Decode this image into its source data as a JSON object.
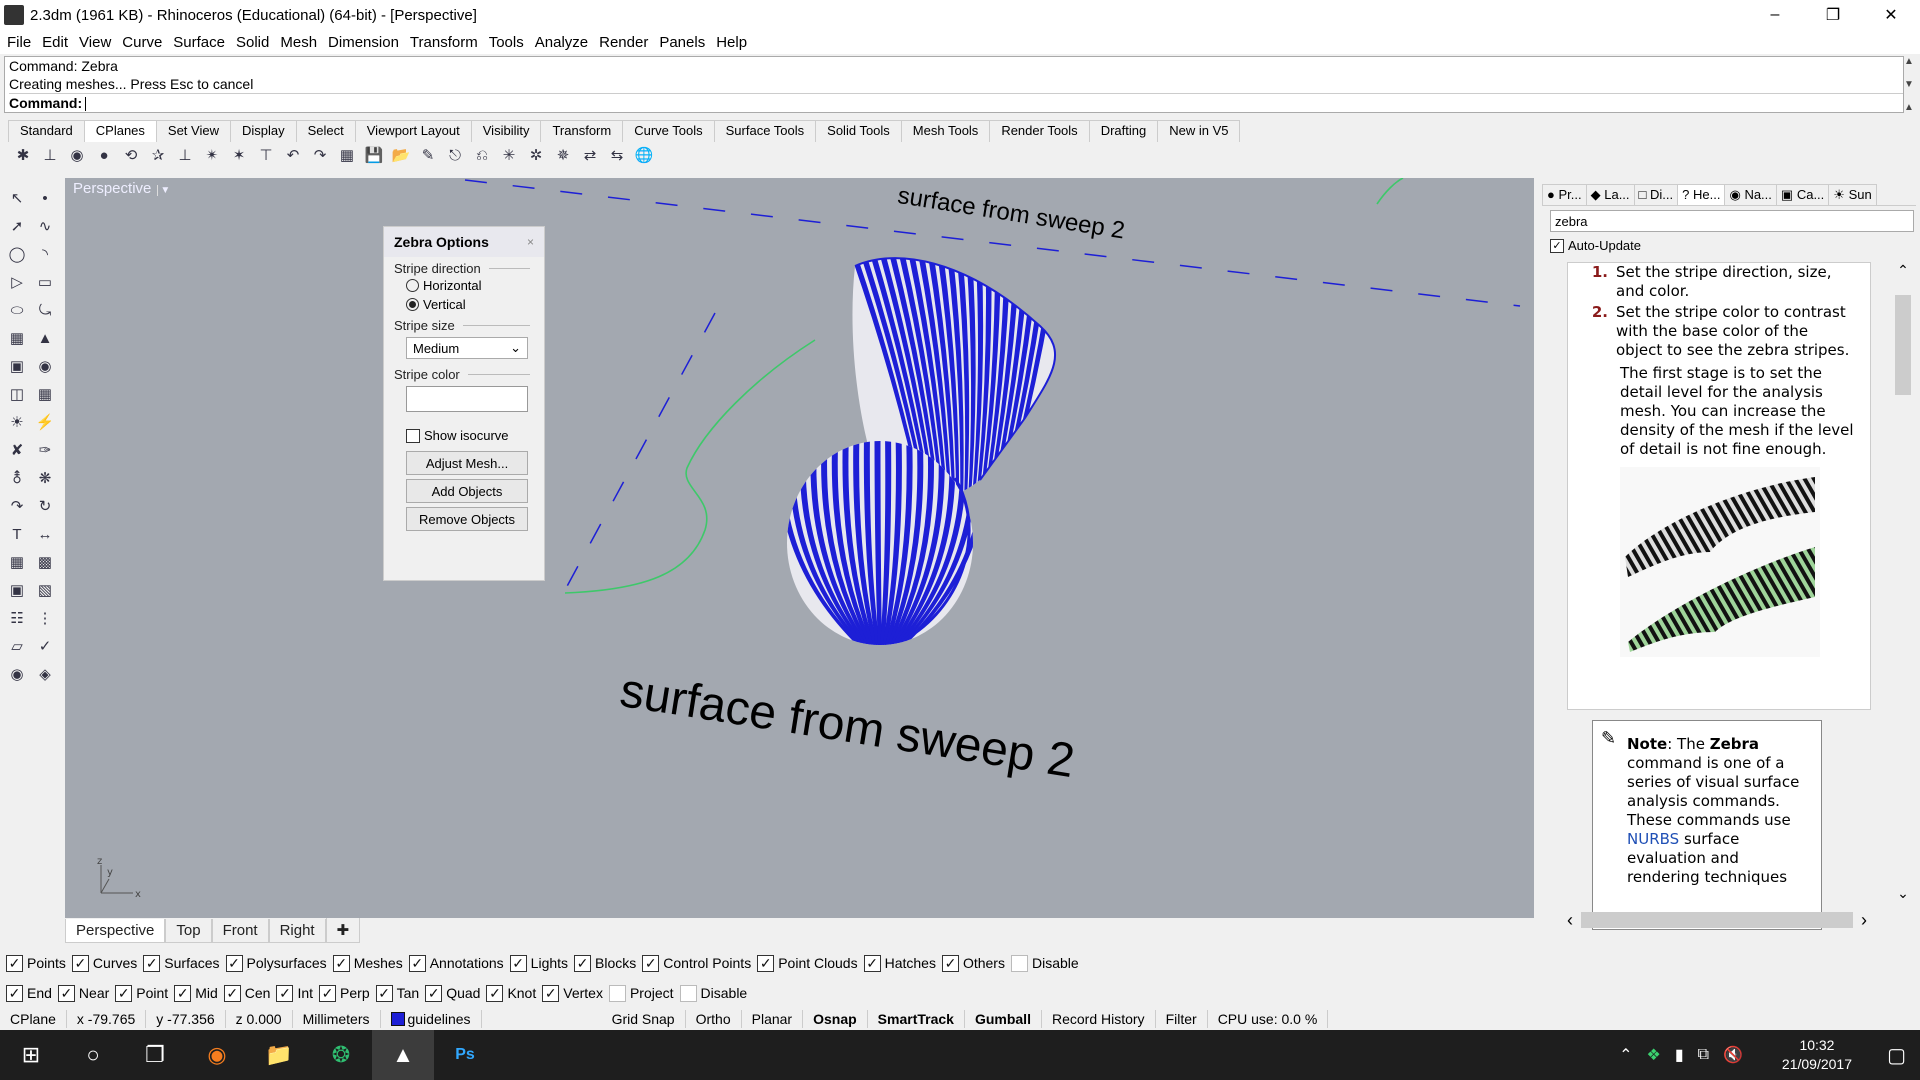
{
  "window": {
    "title": "2.3dm (1961 KB) - Rhinoceros (Educational) (64-bit) - [Perspective]"
  },
  "menu": [
    "File",
    "Edit",
    "View",
    "Curve",
    "Surface",
    "Solid",
    "Mesh",
    "Dimension",
    "Transform",
    "Tools",
    "Analyze",
    "Render",
    "Panels",
    "Help"
  ],
  "command": {
    "history_line1": "Command: Zebra",
    "history_line2": "Creating meshes... Press Esc to cancel",
    "prompt": "Command:"
  },
  "toolbar_tabs": [
    "Standard",
    "CPlanes",
    "Set View",
    "Display",
    "Select",
    "Viewport Layout",
    "Visibility",
    "Transform",
    "Curve Tools",
    "Surface Tools",
    "Solid Tools",
    "Mesh Tools",
    "Render Tools",
    "Drafting",
    "New in V5"
  ],
  "active_toolbar_tab": "CPlanes",
  "viewport": {
    "name": "Perspective",
    "label_large": "surface from sweep 2",
    "label_small": "surface from sweep 2",
    "axis_y": "y",
    "axis_x": "x",
    "axis_z": "z"
  },
  "zebra_options": {
    "title": "Zebra Options",
    "close": "×",
    "stripe_direction_label": "Stripe direction",
    "horizontal": "Horizontal",
    "vertical": "Vertical",
    "selected_direction": "Vertical",
    "stripe_size_label": "Stripe size",
    "stripe_size_value": "Medium",
    "stripe_color_label": "Stripe color",
    "stripe_color": "#ffffff",
    "show_isocurve": "Show isocurve",
    "adjust_mesh": "Adjust Mesh...",
    "add_objects": "Add Objects",
    "remove_objects": "Remove Objects"
  },
  "right_panel": {
    "tabs": [
      "Pr...",
      "La...",
      "Di...",
      "He...",
      "Na...",
      "Ca...",
      "Sun"
    ],
    "active_tab": "He...",
    "search_value": "zebra",
    "auto_update": "Auto-Update",
    "step1_num": "1.",
    "step1": "Set the stripe direction, size, and color.",
    "step2_num": "2.",
    "step2": "Set the stripe color to contrast with the base color of the object to see the zebra stripes.",
    "para": "The first stage is to set the detail level for the analysis mesh. You can increase the density of the mesh if the level of detail is not fine enough.",
    "note_label": "Note",
    "note_pre": ": The ",
    "note_cmd": "Zebra",
    "note_mid": " command is one of a series of visual surface analysis commands. These commands use ",
    "note_link": "NURBS",
    "note_post": " surface evaluation and rendering techniques"
  },
  "viewport_tabs": [
    "Perspective",
    "Top",
    "Front",
    "Right"
  ],
  "active_viewport_tab": "Perspective",
  "filters": [
    {
      "label": "Points",
      "checked": true
    },
    {
      "label": "Curves",
      "checked": true
    },
    {
      "label": "Surfaces",
      "checked": true
    },
    {
      "label": "Polysurfaces",
      "checked": true
    },
    {
      "label": "Meshes",
      "checked": true
    },
    {
      "label": "Annotations",
      "checked": true
    },
    {
      "label": "Lights",
      "checked": true
    },
    {
      "label": "Blocks",
      "checked": true
    },
    {
      "label": "Control Points",
      "checked": true
    },
    {
      "label": "Point Clouds",
      "checked": true
    },
    {
      "label": "Hatches",
      "checked": true
    },
    {
      "label": "Others",
      "checked": true
    },
    {
      "label": "Disable",
      "checked": false
    }
  ],
  "osnaps": [
    {
      "label": "End",
      "checked": true
    },
    {
      "label": "Near",
      "checked": true
    },
    {
      "label": "Point",
      "checked": true
    },
    {
      "label": "Mid",
      "checked": true
    },
    {
      "label": "Cen",
      "checked": true
    },
    {
      "label": "Int",
      "checked": true
    },
    {
      "label": "Perp",
      "checked": true
    },
    {
      "label": "Tan",
      "checked": true
    },
    {
      "label": "Quad",
      "checked": true
    },
    {
      "label": "Knot",
      "checked": true
    },
    {
      "label": "Vertex",
      "checked": true
    },
    {
      "label": "Project",
      "checked": false
    },
    {
      "label": "Disable",
      "checked": false
    }
  ],
  "status": {
    "cplane": "CPlane",
    "x": "x -79.765",
    "y": "y -77.356",
    "z": "z 0.000",
    "units": "Millimeters",
    "layer": "guidelines",
    "layer_color": "#1d1fd6",
    "grid_snap": "Grid Snap",
    "ortho": "Ortho",
    "planar": "Planar",
    "osnap": "Osnap",
    "smarttrack": "SmartTrack",
    "gumball": "Gumball",
    "record_history": "Record History",
    "filter": "Filter",
    "cpu": "CPU use: 0.0 %"
  },
  "taskbar": {
    "time": "10:32",
    "date": "21/09/2017"
  }
}
